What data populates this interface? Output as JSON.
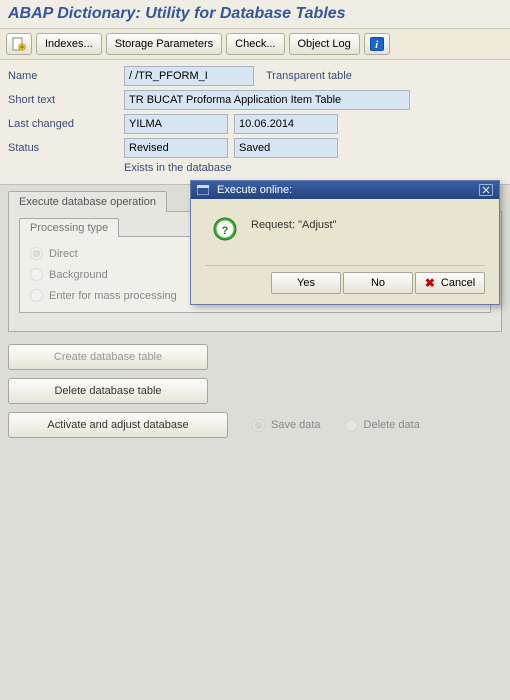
{
  "title": "ABAP Dictionary: Utility for Database Tables",
  "toolbar": {
    "indexes": "Indexes...",
    "storage": "Storage Parameters",
    "check": "Check...",
    "objectlog": "Object Log"
  },
  "fields": {
    "name_label": "Name",
    "name_value": "/        /TR_PFORM_I",
    "name_type": "Transparent table",
    "short_label": "Short text",
    "short_value": "TR BUCAT Proforma Application Item Table",
    "changed_label": "Last changed",
    "changed_by": "YILMA",
    "changed_on": "10.06.2014",
    "status_label": "Status",
    "status1": "Revised",
    "status2": "Saved",
    "exists": "Exists in the database"
  },
  "exec": {
    "group": "Execute database operation",
    "ptype": "Processing type",
    "direct": "Direct",
    "background": "Background",
    "mass": "Enter for mass processing",
    "create": "Create database table",
    "delete": "Delete database table",
    "activate": "Activate and adjust database",
    "save": "Save data",
    "deldata": "Delete data"
  },
  "dialog": {
    "title": "Execute online:",
    "message": "Request: \"Adjust\"",
    "yes": "Yes",
    "no": "No",
    "cancel": "Cancel"
  }
}
